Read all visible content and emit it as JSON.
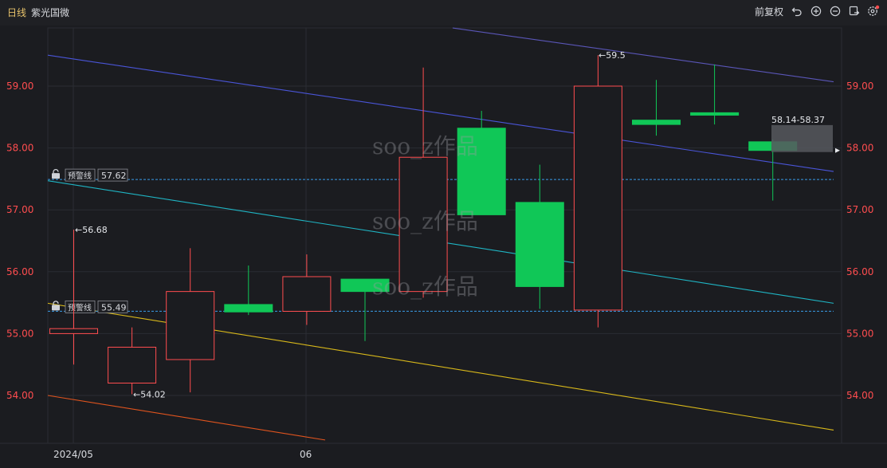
{
  "header": {
    "period": "日线",
    "stock_name": "紫光国微",
    "adjust_label": "前复权"
  },
  "icons": [
    "undo-icon",
    "zoom-in-icon",
    "zoom-out-icon",
    "export-icon",
    "settings-icon"
  ],
  "colors": {
    "up": "#ff4d4f",
    "down": "#10c757",
    "grid": "#2b2d33",
    "alert_line": "#3a9ce8",
    "trend_blue": "#4a55d8",
    "trend_purple": "#5a56b8",
    "trend_cyan": "#1fb5c4",
    "trend_yellow": "#d8b81a",
    "trend_orange": "#e0541e"
  },
  "alert_lines": [
    {
      "label": "预警线",
      "value": "57.62"
    },
    {
      "label": "预警线",
      "value": "55.49"
    }
  ],
  "range_box_label": "58.14-58.37",
  "price_annotations": [
    {
      "text": "←56.68"
    },
    {
      "text": "←54.02"
    },
    {
      "text": "←59.5"
    }
  ],
  "watermark": "soo_z作品",
  "chart_data": {
    "type": "candlestick",
    "y_axis_ticks": [
      "59.00",
      "58.00",
      "57.00",
      "56.00",
      "55.00",
      "54.00"
    ],
    "ylim": [
      53.3,
      59.95
    ],
    "x_tick_labels": [
      "2024/05",
      "06"
    ],
    "candles": [
      {
        "open": 55.0,
        "close": 55.08,
        "high": 56.68,
        "low": 54.5
      },
      {
        "open": 54.2,
        "close": 54.78,
        "high": 55.1,
        "low": 54.02
      },
      {
        "open": 54.58,
        "close": 55.68,
        "high": 56.38,
        "low": 54.05
      },
      {
        "open": 55.47,
        "close": 55.35,
        "high": 56.1,
        "low": 55.3
      },
      {
        "open": 55.36,
        "close": 55.92,
        "high": 56.28,
        "low": 55.14
      },
      {
        "open": 55.88,
        "close": 55.68,
        "high": 55.88,
        "low": 54.88
      },
      {
        "open": 55.68,
        "close": 57.85,
        "high": 59.3,
        "low": 55.58
      },
      {
        "open": 58.32,
        "close": 56.92,
        "high": 58.6,
        "low": 56.92
      },
      {
        "open": 57.12,
        "close": 55.76,
        "high": 57.73,
        "low": 55.4
      },
      {
        "open": 55.38,
        "close": 59.0,
        "high": 59.5,
        "low": 55.1
      },
      {
        "open": 58.45,
        "close": 58.38,
        "high": 59.1,
        "low": 58.2
      },
      {
        "open": 58.57,
        "close": 58.53,
        "high": 59.35,
        "low": 58.38
      },
      {
        "open": 58.1,
        "close": 57.96,
        "high": 58.14,
        "low": 57.15
      }
    ]
  }
}
